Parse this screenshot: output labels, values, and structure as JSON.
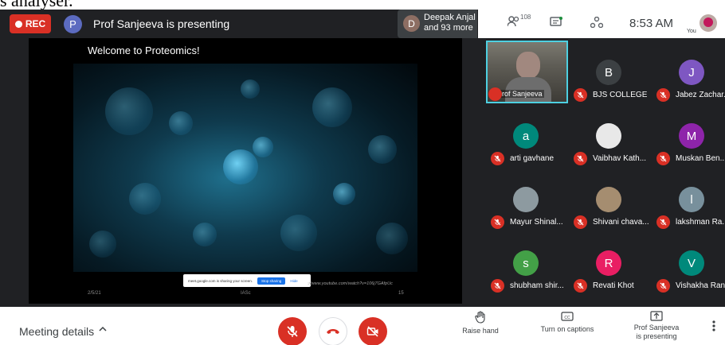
{
  "top_strip_text": "s analyser.",
  "header": {
    "rec_label": "REC",
    "presenter_avatar_letter": "P",
    "presenting_text": "Prof Sanjeeva is presenting",
    "attendees_avatar_letter": "D",
    "attendees_line1": "Deepak Anjal",
    "attendees_line2": "and 93 more",
    "people_count": "108",
    "time": "8:53 AM",
    "you_label": "You"
  },
  "slide": {
    "title": "Welcome to Proteomics!",
    "date": "2/5/21",
    "org": "IASc",
    "page": "15",
    "url": "://www.youtube.com/watch?v=106j7GAfpUc",
    "share_text": "meet.google.com is sharing your screen.",
    "stop_sharing": "Stop sharing",
    "hide": "Hide"
  },
  "participants": [
    {
      "name": "Prof Sanjeeva",
      "letter": "",
      "color": "",
      "video": true
    },
    {
      "name": "BJS COLLEGE",
      "letter": "B",
      "color": "#3c4043",
      "video": false
    },
    {
      "name": "Jabez Zachar...",
      "letter": "J",
      "color": "#7e57c2",
      "video": false
    },
    {
      "name": "arti gavhane",
      "letter": "a",
      "color": "#00897b",
      "video": false
    },
    {
      "name": "Vaibhav Kath...",
      "letter": "",
      "color": "#e8e8e8",
      "video": false
    },
    {
      "name": "Muskan Ben...",
      "letter": "M",
      "color": "#8e24aa",
      "video": false
    },
    {
      "name": "Mayur Shinal...",
      "letter": "",
      "color": "#8d9aa0",
      "video": false
    },
    {
      "name": "Shivani chava...",
      "letter": "",
      "color": "#a58d70",
      "video": false
    },
    {
      "name": "lakshman Ra...",
      "letter": "l",
      "color": "#78909c",
      "video": false
    },
    {
      "name": "shubham shir...",
      "letter": "s",
      "color": "#43a047",
      "video": false
    },
    {
      "name": "Revati Khot",
      "letter": "R",
      "color": "#e91e63",
      "video": false
    },
    {
      "name": "Vishakha Rane",
      "letter": "V",
      "color": "#00897b",
      "video": false
    }
  ],
  "bottom": {
    "meeting_details": "Meeting details",
    "raise_hand": "Raise hand",
    "captions": "Turn on captions",
    "present_line1": "Prof Sanjeeva",
    "present_line2": "is presenting"
  },
  "colors": {
    "rec": "#d93025",
    "dark_bg": "#202124",
    "accent": "#1a73e8",
    "highlight_border": "#4dd0e1"
  },
  "icons": {
    "people": "people-icon",
    "chat": "chat-icon",
    "activities": "activities-icon",
    "mic_off": "mic-off-icon",
    "end_call": "end-call-icon",
    "camera_off": "camera-off-icon",
    "raise_hand": "hand-icon",
    "captions": "captions-icon",
    "present": "present-icon",
    "more": "more-icon"
  }
}
